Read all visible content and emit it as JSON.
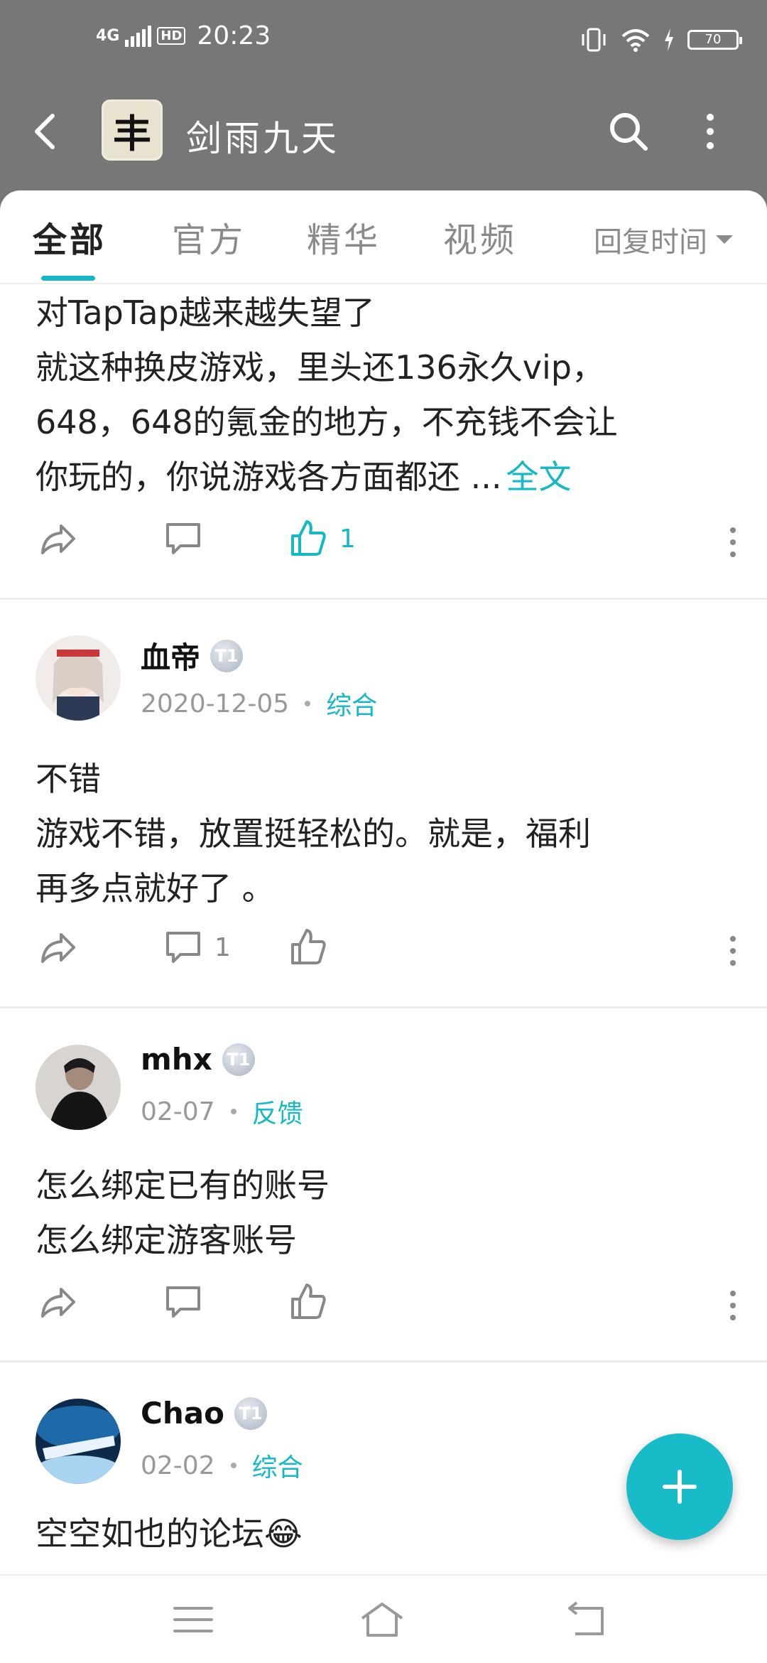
{
  "status_bar": {
    "network": "4G",
    "hd": "HD",
    "time": "20:23",
    "battery": "70"
  },
  "app_bar": {
    "icon_char": "丰",
    "title": "剑雨九天"
  },
  "tabs": [
    {
      "label": "全部",
      "active": true
    },
    {
      "label": "官方",
      "active": false
    },
    {
      "label": "精华",
      "active": false
    },
    {
      "label": "视频",
      "active": false
    }
  ],
  "sort": {
    "label": "回复时间"
  },
  "posts": [
    {
      "lines": [
        "对TapTap越来越失望了",
        "就这种换皮游戏，里头还136永久vip，",
        "648，648的氪金的地方，不充钱不会让",
        "你玩的，你说游戏各方面都还 ..."
      ],
      "more_label": "全文",
      "comments": "",
      "likes": "1"
    },
    {
      "user": "血帝",
      "level": "T1",
      "date": "2020-12-05",
      "category": "综合",
      "lines": [
        "不错",
        "游戏不错，放置挺轻松的。就是，福利",
        "再多点就好了 。"
      ],
      "comments": "1",
      "likes": ""
    },
    {
      "user": "mhx",
      "level": "T1",
      "date": "02-07",
      "category": "反馈",
      "lines": [
        "怎么绑定已有的账号",
        "怎么绑定游客账号"
      ],
      "comments": "",
      "likes": ""
    },
    {
      "user": "Chao",
      "level": "T1",
      "date": "02-02",
      "category": "综合",
      "lines": [
        "空空如也的论坛😂"
      ]
    }
  ],
  "colors": {
    "accent": "#15b8c5",
    "header_bg": "#777777"
  },
  "icons": [
    "back-icon",
    "search-icon",
    "more-vertical-icon",
    "share-icon",
    "comment-icon",
    "thumbs-up-icon",
    "plus-icon",
    "menu-icon",
    "home-icon",
    "return-icon"
  ]
}
